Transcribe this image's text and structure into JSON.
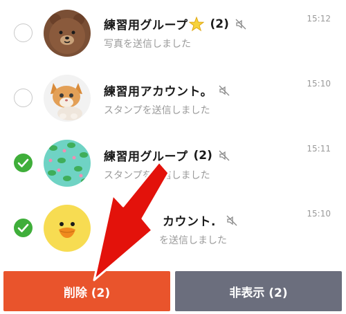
{
  "chats": [
    {
      "name": "練習用グループ",
      "has_star": true,
      "count": "(2)",
      "muted": true,
      "preview": "写真を送信しました",
      "time": "15:12",
      "selected": false,
      "avatar_icon": "bear-icon"
    },
    {
      "name": "練習用アカウント。",
      "has_star": false,
      "count": "",
      "muted": true,
      "preview": "スタンプを送信しました",
      "time": "15:10",
      "selected": false,
      "avatar_icon": "kitten-photo"
    },
    {
      "name": "練習用グループ",
      "has_star": false,
      "count": "(2)",
      "muted": true,
      "preview": "スタンプを送信しました",
      "time": "15:11",
      "selected": true,
      "avatar_icon": "frog-pattern-icon"
    },
    {
      "name": "カウント.",
      "has_star": false,
      "count": "",
      "muted": true,
      "preview": "を送信しました",
      "time": "15:10",
      "selected": true,
      "avatar_icon": "chick-icon"
    }
  ],
  "actions": {
    "delete_label": "削除 (2)",
    "hide_label": "非表示 (2)"
  },
  "colors": {
    "check_green": "#3fae3a",
    "delete_red": "#e9542c",
    "hide_gray": "#6b6e7d",
    "arrow_red": "#e3120b"
  }
}
